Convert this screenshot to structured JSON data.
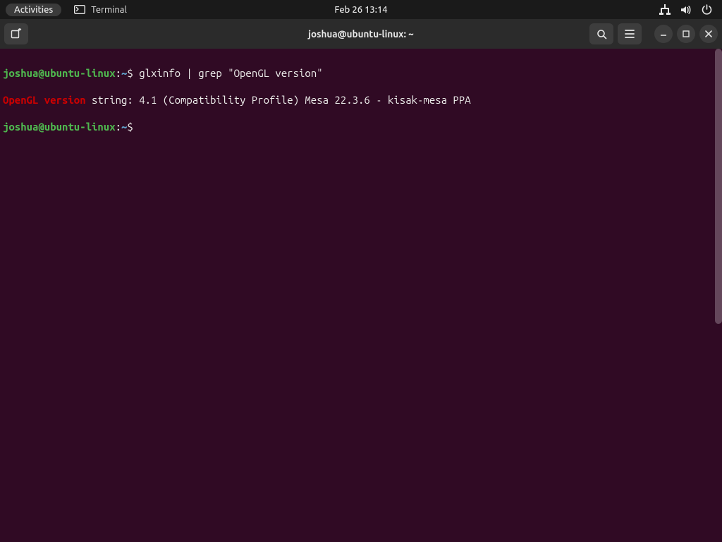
{
  "panel": {
    "activities": "Activities",
    "app_label": "Terminal",
    "clock": "Feb 26  13:14"
  },
  "icons": {
    "terminal": "terminal-icon",
    "network": "wired-network-icon",
    "volume": "volume-icon",
    "power": "power-icon",
    "new_tab": "new-tab-icon",
    "search": "search-icon",
    "menu": "hamburger-menu-icon",
    "minimize": "minimize-icon",
    "maximize": "maximize-icon",
    "close": "close-icon"
  },
  "window": {
    "title": "joshua@ubuntu-linux: ~"
  },
  "term": {
    "userhost": "joshua@ubuntu-linux",
    "sep": ":",
    "cwd": "~",
    "dollar": "$",
    "cmd1": " glxinfo | grep \"OpenGL version\"",
    "hl": "OpenGL version",
    "out_rest": " string: 4.1 (Compatibility Profile) Mesa 22.3.6 - kisak-mesa PPA",
    "cmd2": " "
  },
  "colors": {
    "panel_bg": "#1a1a1a",
    "terminal_bg": "#300a24",
    "prompt_user": "#4fb84f",
    "prompt_cwd": "#5f9ec7",
    "grep_highlight": "#cc0000"
  }
}
